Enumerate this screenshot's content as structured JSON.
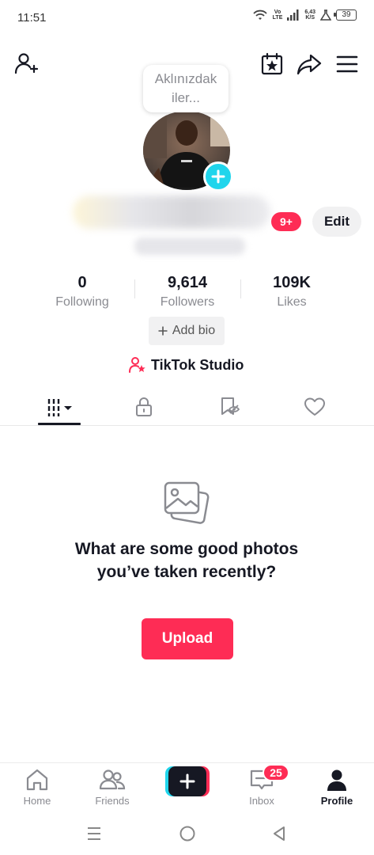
{
  "status_bar": {
    "time": "11:51",
    "network_line1": "Vo",
    "network_line2": "LTE",
    "speed_value": "6,43",
    "speed_unit": "K/S",
    "battery": "39"
  },
  "profile": {
    "note_text": "Aklınızdak iler...",
    "notification_badge": "9+",
    "edit_label": "Edit",
    "stats": [
      {
        "value": "0",
        "label": "Following"
      },
      {
        "value": "9,614",
        "label": "Followers"
      },
      {
        "value": "109K",
        "label": "Likes"
      }
    ],
    "add_bio_label": "Add bio",
    "studio_label": "TikTok Studio"
  },
  "empty_state": {
    "message": "What are some good photos you’ve taken recently?",
    "upload_label": "Upload"
  },
  "bottom_nav": {
    "items": [
      {
        "label": "Home"
      },
      {
        "label": "Friends"
      },
      {
        "label": "Inbox"
      },
      {
        "label": "Profile"
      }
    ],
    "inbox_badge": "25"
  },
  "colors": {
    "accent": "#fe2c55",
    "cyan": "#20d5ec",
    "text": "#161823",
    "muted": "#8a8b91"
  }
}
